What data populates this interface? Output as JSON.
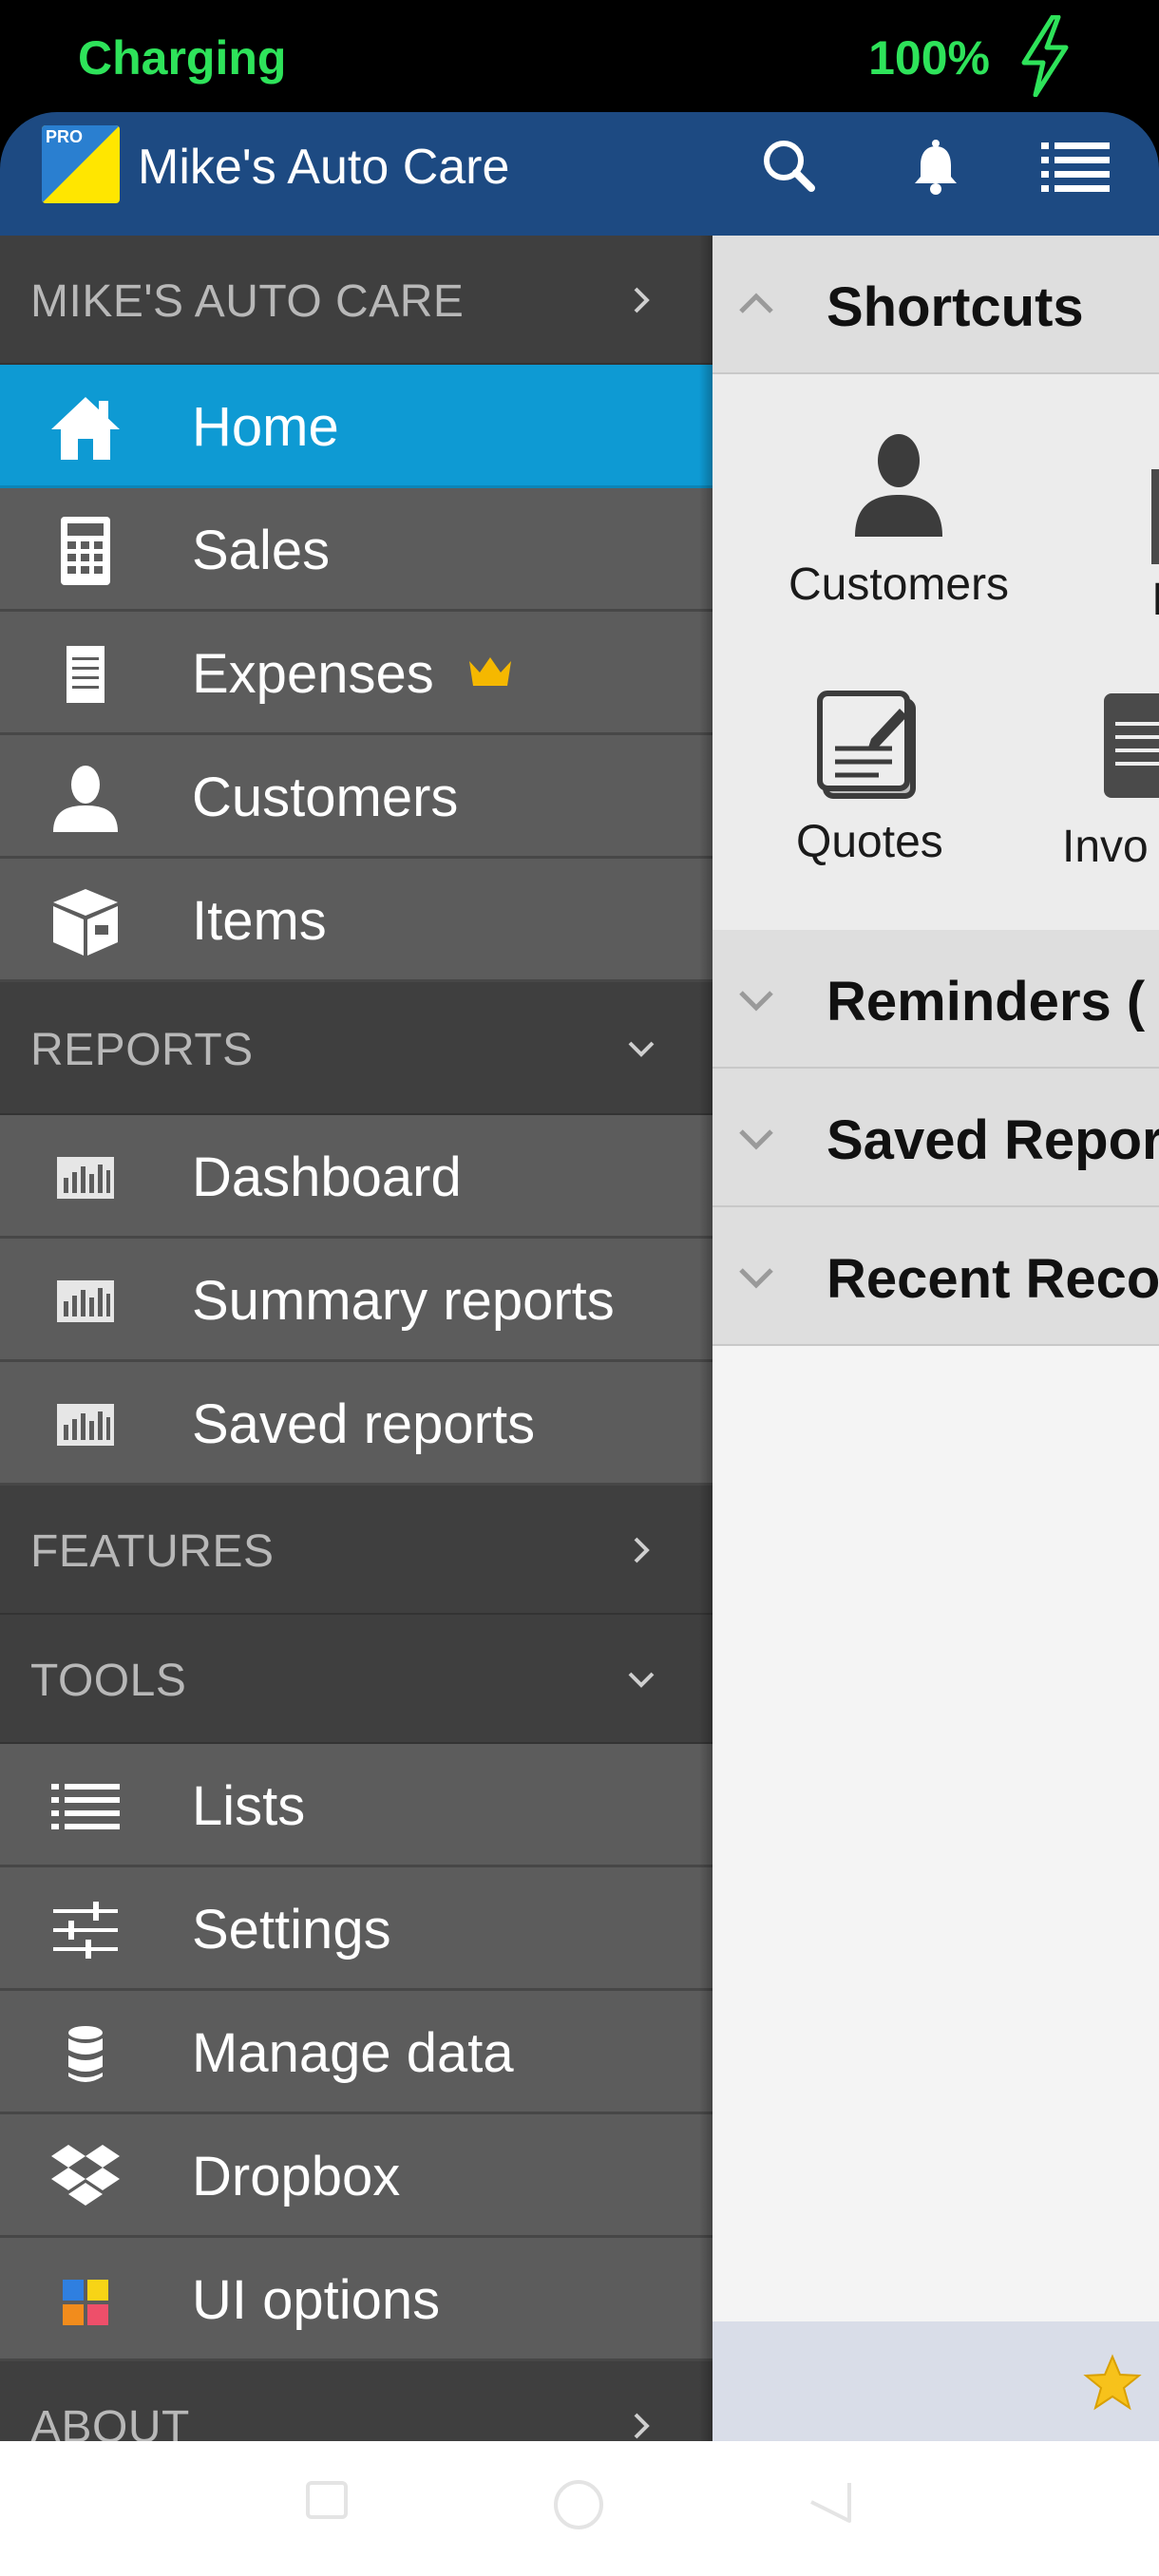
{
  "status_bar": {
    "charging": "Charging",
    "battery": "100%"
  },
  "app_bar": {
    "logo_badge": "PRO",
    "title": "Mike's Auto Care"
  },
  "drawer": {
    "business_section": "MIKE'S AUTO CARE",
    "main_items": [
      {
        "label": "Home",
        "icon": "home-icon",
        "active": true
      },
      {
        "label": "Sales",
        "icon": "calculator-icon"
      },
      {
        "label": "Expenses",
        "icon": "receipt-icon"
      },
      {
        "label": "Customers",
        "icon": "person-icon"
      },
      {
        "label": "Items",
        "icon": "box-icon"
      }
    ],
    "reports_section": "REPORTS",
    "report_items": [
      {
        "label": "Dashboard",
        "icon": "bar-chart-icon"
      },
      {
        "label": "Summary reports",
        "icon": "bar-chart-icon"
      },
      {
        "label": "Saved reports",
        "icon": "bar-chart-icon"
      }
    ],
    "features_section": "FEATURES",
    "tools_section": "TOOLS",
    "tool_items": [
      {
        "label": "Lists",
        "icon": "list-icon"
      },
      {
        "label": "Settings",
        "icon": "sliders-icon"
      },
      {
        "label": "Manage data",
        "icon": "database-icon"
      },
      {
        "label": "Dropbox",
        "icon": "dropbox-icon"
      },
      {
        "label": "UI options",
        "icon": "palette-icon"
      }
    ],
    "about_section": "ABOUT"
  },
  "content": {
    "shortcuts_title": "Shortcuts",
    "shortcuts": [
      {
        "label": "Customers",
        "icon": "person-icon"
      },
      {
        "label": "Quotes",
        "icon": "quote-document-icon"
      },
      {
        "label": "Invo",
        "icon": "invoice-document-icon"
      }
    ],
    "shortcut_partial_label": "I",
    "sections": [
      "Reminders (",
      "Saved Repor",
      "Recent Reco"
    ]
  },
  "colors": {
    "app_bar": "#1d4a82",
    "active_item": "#0e9ad3",
    "status_text": "#2ee35a"
  }
}
